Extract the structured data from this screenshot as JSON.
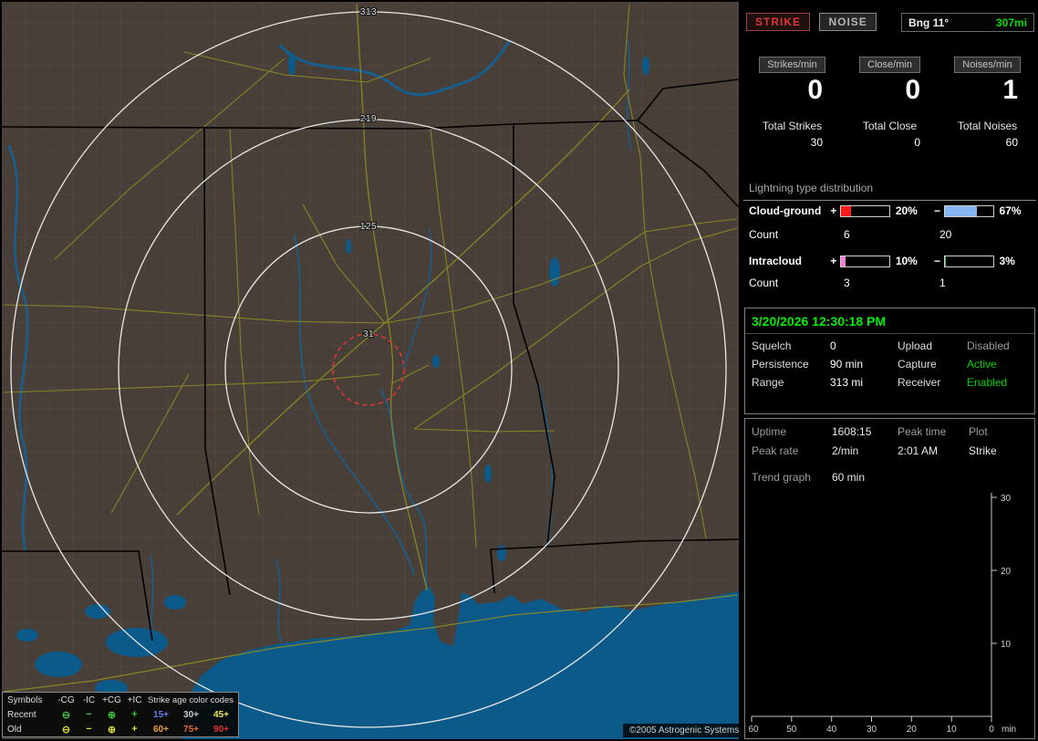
{
  "map": {
    "ring_labels": [
      "313",
      "219",
      "125",
      "31"
    ],
    "copyright": "©2005 Astrogenic Systems",
    "legend": {
      "symbols_header": "Symbols",
      "symbol_cols": [
        "-CG",
        "-IC",
        "+CG",
        "+IC"
      ],
      "age_header": "Strike age color codes",
      "rows": [
        {
          "label": "Recent",
          "glyphs": [
            "⊖",
            "−",
            "⊕",
            "+"
          ],
          "glyph_color": "#3fc43f",
          "ages": [
            {
              "text": "15+",
              "color": "#5f7df2"
            },
            {
              "text": "30+",
              "color": "#c9c9c9"
            },
            {
              "text": "45+",
              "color": "#e8e84f"
            }
          ]
        },
        {
          "label": "Old",
          "glyphs": [
            "⊖",
            "−",
            "⊕",
            "+"
          ],
          "glyph_color": "#d8d83a",
          "ages": [
            {
              "text": "60+",
              "color": "#e8a33c"
            },
            {
              "text": "75+",
              "color": "#e86a2e"
            },
            {
              "text": "90+",
              "color": "#e83030"
            }
          ]
        }
      ]
    }
  },
  "panel": {
    "strike_button": "STRIKE",
    "noise_button": "NOISE",
    "bearing_label": "Bng 11°",
    "bearing_range": "307mi",
    "columns": [
      {
        "header": "Strikes/min",
        "rate": "0",
        "total_label": "Total Strikes",
        "total_value": "30"
      },
      {
        "header": "Close/min",
        "rate": "0",
        "total_label": "Total Close",
        "total_value": "0"
      },
      {
        "header": "Noises/min",
        "rate": "1",
        "total_label": "Total Noises",
        "total_value": "60"
      }
    ],
    "distribution": {
      "title": "Lightning type distribution",
      "rows": [
        {
          "label": "Cloud-ground",
          "plus_sign": "+",
          "minus_sign": "−",
          "pos_pct": 20,
          "pos_pct_label": "20%",
          "pos_color": "#ff1a1a",
          "neg_pct": 67,
          "neg_pct_label": "67%",
          "neg_color": "#85b6f2",
          "count_label": "Count",
          "pos_count": "6",
          "neg_count": "20"
        },
        {
          "label": "Intracloud",
          "plus_sign": "+",
          "minus_sign": "−",
          "pos_pct": 10,
          "pos_pct_label": "10%",
          "pos_color": "#f27fd2",
          "neg_pct": 3,
          "neg_pct_label": "3%",
          "neg_color": "#27c53f",
          "count_label": "Count",
          "pos_count": "3",
          "neg_count": "1"
        }
      ]
    },
    "status": {
      "datetime": "3/20/2026 12:30:18 PM",
      "rows": [
        {
          "key1": "Squelch",
          "val1": "0",
          "key2": "Upload",
          "val2": "Disabled",
          "val2_color": "#9c9c9c"
        },
        {
          "key1": "Persistence",
          "val1": "90 min",
          "key2": "Capture",
          "val2": "Active",
          "val2_color": "#00d400"
        },
        {
          "key1": "Range",
          "val1": "313 mi",
          "key2": "Receiver",
          "val2": "Enabled",
          "val2_color": "#00d400"
        }
      ]
    },
    "stats": {
      "row1": {
        "key1": "Uptime",
        "val1": "1608:15",
        "key2": "Peak time",
        "key3": "Plot"
      },
      "row2": {
        "key1": "Peak rate",
        "val1": "2/min",
        "val2": "2:01 AM",
        "val3": "Strike"
      },
      "trend_label": "Trend graph",
      "trend_value": "60 min"
    },
    "trend_chart": {
      "y_ticks": [
        "30",
        "20",
        "10"
      ],
      "x_ticks": [
        "60",
        "50",
        "40",
        "30",
        "20",
        "10",
        "0"
      ],
      "x_unit": "min"
    }
  },
  "chart_data": {
    "type": "line",
    "title": "Strike trend graph (last 60 min)",
    "xlabel": "min",
    "ylabel": "",
    "x_ticks": [
      60,
      50,
      40,
      30,
      20,
      10,
      0
    ],
    "ylim": [
      0,
      30
    ],
    "series": [],
    "note": "Trend graph axes displayed with no plotted strike data"
  }
}
